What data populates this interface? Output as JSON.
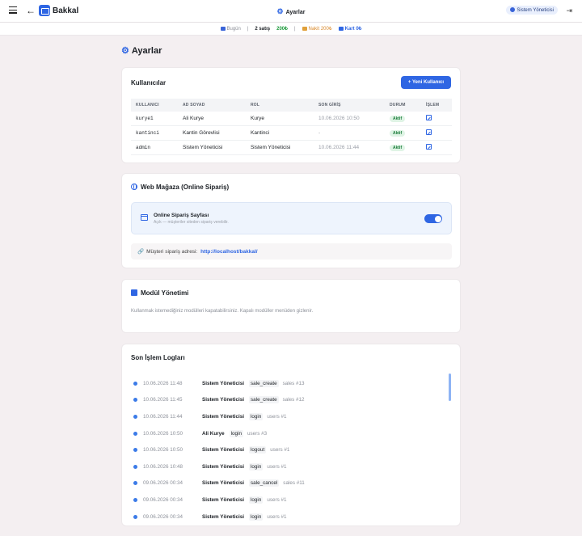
{
  "header": {
    "app_name": "Bakkal",
    "page_title": "Ayarlar",
    "user": "Sistem Yöneticisi"
  },
  "stats": {
    "today_label": "Bugün",
    "sales_count": "2 satış",
    "total": "200₺",
    "cash": "Nakit 200₺",
    "card": "Kart 0₺"
  },
  "title": "Ayarlar",
  "users_card": {
    "title": "Kullanıcılar",
    "new_user_button": "+ Yeni Kullanıcı",
    "columns": [
      "KULLANICI",
      "AD SOYAD",
      "ROL",
      "SON GİRİŞ",
      "DURUM",
      "İŞLEM"
    ],
    "rows": [
      {
        "username": "kurye1",
        "full_name": "Ali Kurye",
        "role": "Kurye",
        "last_login": "10.06.2026 10:50",
        "status": "Aktif"
      },
      {
        "username": "kantinci",
        "full_name": "Kantin Görevlisi",
        "role": "Kantinci",
        "last_login": "-",
        "status": "Aktif"
      },
      {
        "username": "admin",
        "full_name": "Sistem Yöneticisi",
        "role": "Sistem Yöneticisi",
        "last_login": "10.06.2026 11:44",
        "status": "Aktif"
      }
    ]
  },
  "web_store": {
    "title": "Web Mağaza (Online Sipariş)",
    "page_title": "Online Sipariş Sayfası",
    "page_subtitle": "Açık — müşteriler siteden sipariş verebilir.",
    "toggle_on": true,
    "url_label": "Müşteri sipariş adresi:",
    "url": "http://localhost/bakkal/"
  },
  "modules": {
    "title": "Modül Yönetimi",
    "note": "Kullanmak istemediğiniz modülleri kapatabilirsiniz. Kapalı modüller menüden gizlenir."
  },
  "logs": {
    "title": "Son İşlem Logları",
    "items": [
      {
        "time": "10.06.2026 11:48",
        "user": "Sistem Yöneticisi",
        "action": "sale_create",
        "target": "sales #13"
      },
      {
        "time": "10.06.2026 11:45",
        "user": "Sistem Yöneticisi",
        "action": "sale_create",
        "target": "sales #12"
      },
      {
        "time": "10.06.2026 11:44",
        "user": "Sistem Yöneticisi",
        "action": "login",
        "target": "users #1"
      },
      {
        "time": "10.06.2026 10:50",
        "user": "Ali Kurye",
        "action": "login",
        "target": "users #3"
      },
      {
        "time": "10.06.2026 10:50",
        "user": "Sistem Yöneticisi",
        "action": "logout",
        "target": "users #1"
      },
      {
        "time": "10.06.2026 10:48",
        "user": "Sistem Yöneticisi",
        "action": "login",
        "target": "users #1"
      },
      {
        "time": "09.06.2026 00:34",
        "user": "Sistem Yöneticisi",
        "action": "sale_cancel",
        "target": "sales #11"
      },
      {
        "time": "09.06.2026 00:34",
        "user": "Sistem Yöneticisi",
        "action": "login",
        "target": "users #1"
      },
      {
        "time": "09.06.2026 00:34",
        "user": "Sistem Yöneticisi",
        "action": "login",
        "target": "users #1"
      }
    ]
  }
}
